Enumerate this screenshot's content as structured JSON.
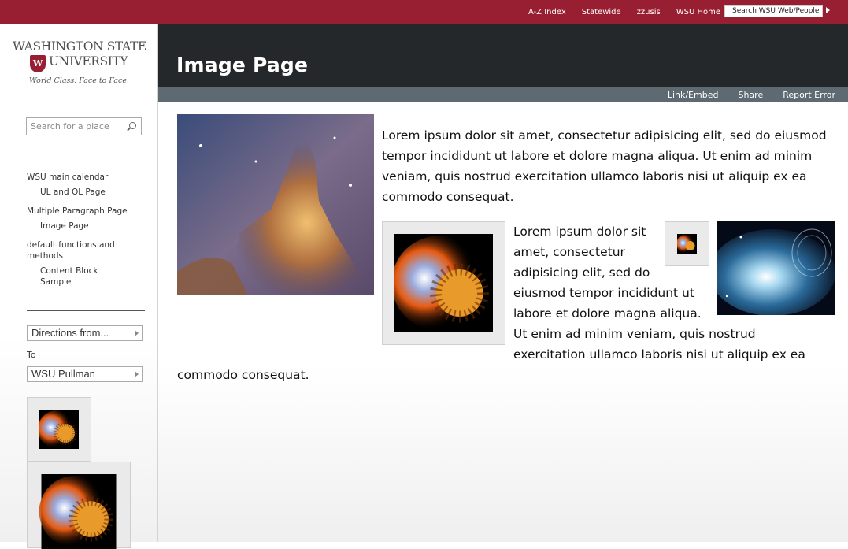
{
  "topbar": {
    "links": [
      "A-Z Index",
      "Statewide",
      "zzusis",
      "WSU Home"
    ],
    "search_placeholder": "Search WSU Web/People"
  },
  "logo": {
    "line1": "WASHINGTON STATE",
    "line2": "UNIVERSITY",
    "tagline": "World Class. Face to Face."
  },
  "sidebar": {
    "search_placeholder": "Search for a place",
    "nav": [
      {
        "label": "WSU main calendar",
        "level": 1
      },
      {
        "label": "UL and OL Page",
        "level": 2
      },
      {
        "label": "Multiple Paragraph Page",
        "level": 1
      },
      {
        "label": "Image Page",
        "level": 2
      },
      {
        "label": "default functions and methods",
        "level": 1
      },
      {
        "label": "Content Block Sample",
        "level": 2
      }
    ],
    "directions_from": "Directions from...",
    "to_label": "To",
    "to_value": "WSU Pullman"
  },
  "header": {
    "title": "Image Page"
  },
  "toolbar": {
    "items": [
      "Link/Embed",
      "Share",
      "Report Error"
    ]
  },
  "content": {
    "para1": "Lorem ipsum dolor sit amet, consectetur adipisicing elit, sed do eiusmod tempor incididunt ut labore et dolore magna aliqua. Ut enim ad minim veniam, quis nostrud exercitation ullamco laboris nisi ut aliquip ex ea commodo consequat.",
    "para2_lines": [
      "Lorem ipsum dolor sit",
      "amet, consectetur",
      "adipisicing elit, sed do",
      "eiusmod tempor incididunt ut",
      "labore et dolore magna aliqua.",
      "Ut enim ad minim veniam, quis nostrud",
      "exercitation ullamco laboris nisi ut aliquip ex ea"
    ],
    "para2_last": "commodo consequat."
  },
  "colors": {
    "brand": "#981e32",
    "header": "#25282b",
    "toolbar": "#5e6a71"
  }
}
